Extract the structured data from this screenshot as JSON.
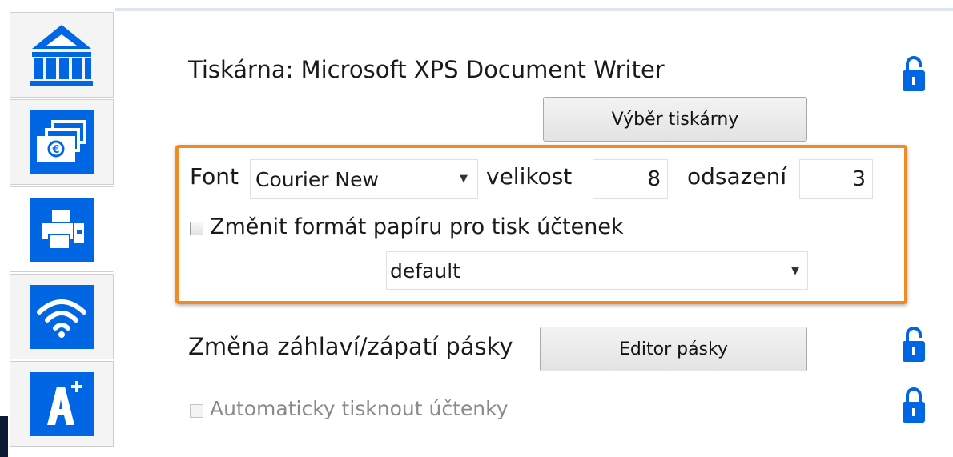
{
  "sidebar": {
    "items": [
      {
        "name": "bank-icon"
      },
      {
        "name": "money-cards-icon"
      },
      {
        "name": "printer-icon",
        "active": true
      },
      {
        "name": "wifi-icon"
      },
      {
        "name": "font-size-icon"
      }
    ]
  },
  "printer": {
    "label": "Tiskárna: Microsoft XPS Document Writer",
    "select_button": "Výběr tiskárny"
  },
  "font": {
    "label": "Font",
    "value": "Courier New",
    "size_label": "velikost",
    "size_value": "8",
    "indent_label": "odsazení",
    "indent_value": "3"
  },
  "paper": {
    "change_format_label": "Změnit formát papíru pro tisk účtenek",
    "format_value": "default"
  },
  "header_footer": {
    "label": "Změna záhlaví/zápatí pásky",
    "editor_button": "Editor pásky"
  },
  "auto_print": {
    "label": "Automaticky tisknout účtenky"
  },
  "colors": {
    "accent": "#0066e3",
    "highlight": "#f08a24"
  }
}
